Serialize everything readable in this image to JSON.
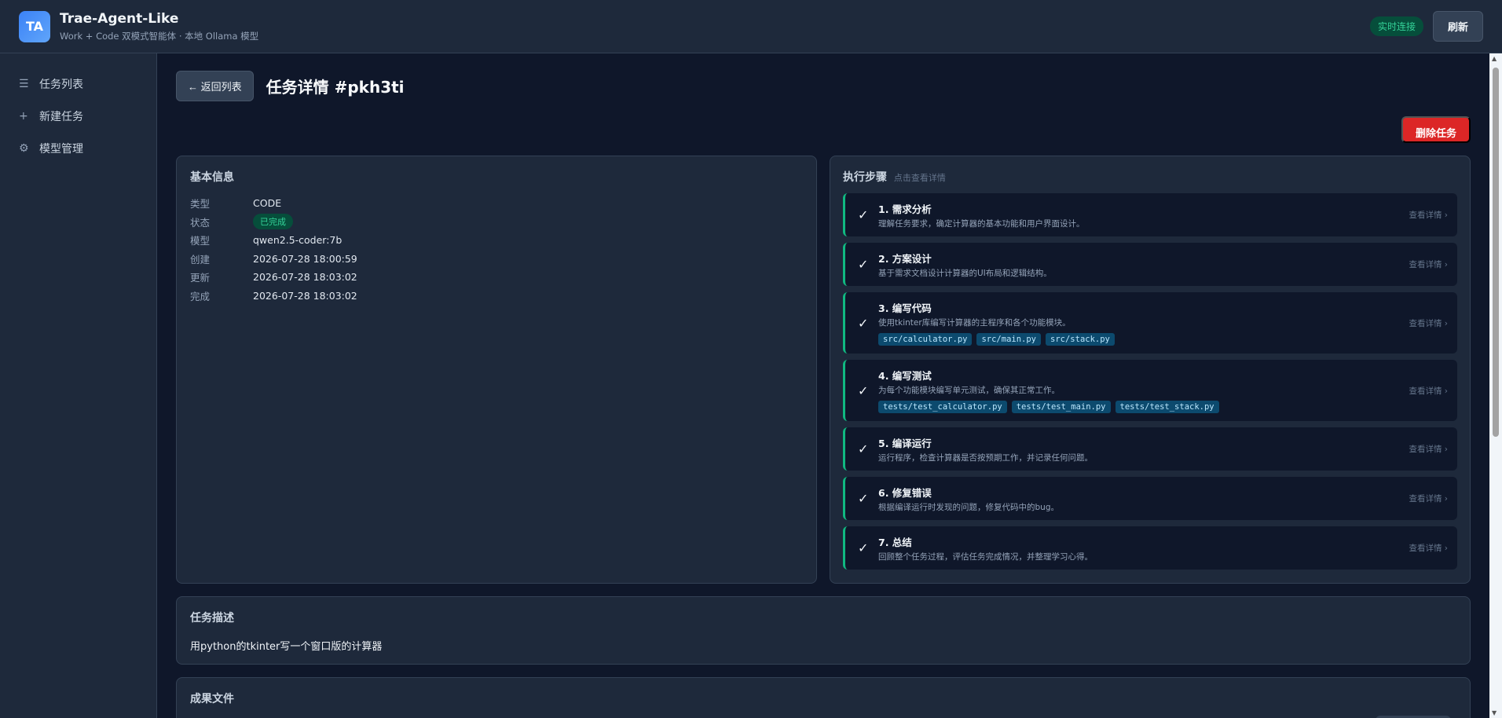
{
  "app": {
    "logo_text": "TA",
    "title": "Trae-Agent-Like",
    "subtitle": "Work + Code 双模式智能体 · 本地 Ollama 模型",
    "live_badge": "实时连接",
    "refresh_label": "刷新"
  },
  "sidebar": {
    "items": [
      {
        "icon": "list-icon",
        "glyph": "☰",
        "label": "任务列表"
      },
      {
        "icon": "plus-icon",
        "glyph": "+",
        "label": "新建任务"
      },
      {
        "icon": "gear-icon",
        "glyph": "⚙",
        "label": "模型管理"
      }
    ]
  },
  "header": {
    "back_label": "← 返回列表",
    "title": "任务详情 #pkh3ti",
    "delete_label": "删除任务"
  },
  "info": {
    "title": "基本信息",
    "rows": [
      {
        "label": "类型",
        "value": "CODE"
      },
      {
        "label": "状态",
        "value": "已完成"
      },
      {
        "label": "模型",
        "value": "qwen2.5-coder:7b"
      },
      {
        "label": "创建",
        "value": "2026-07-28 18:00:59"
      },
      {
        "label": "更新",
        "value": "2026-07-28 18:03:02"
      },
      {
        "label": "完成",
        "value": "2026-07-28 18:03:02"
      }
    ]
  },
  "steps": {
    "title": "执行步骤",
    "hint": "点击查看详情",
    "link_label": "查看详情 ›",
    "check_glyph": "✓",
    "items": [
      {
        "name": "1. 需求分析",
        "desc": "理解任务要求，确定计算器的基本功能和用户界面设计。",
        "files": []
      },
      {
        "name": "2. 方案设计",
        "desc": "基于需求文档设计计算器的UI布局和逻辑结构。",
        "files": []
      },
      {
        "name": "3. 编写代码",
        "desc": "使用tkinter库编写计算器的主程序和各个功能模块。",
        "files": [
          "src/calculator.py",
          "src/main.py",
          "src/stack.py"
        ]
      },
      {
        "name": "4. 编写测试",
        "desc": "为每个功能模块编写单元测试，确保其正常工作。",
        "files": [
          "tests/test_calculator.py",
          "tests/test_main.py",
          "tests/test_stack.py"
        ]
      },
      {
        "name": "5. 编译运行",
        "desc": "运行程序，检查计算器是否按预期工作，并记录任何问题。",
        "files": []
      },
      {
        "name": "6. 修复错误",
        "desc": "根据编译运行时发现的问题，修复代码中的bug。",
        "files": []
      },
      {
        "name": "7. 总结",
        "desc": "回顾整个任务过程，评估任务完成情况，并整理学习心得。",
        "files": []
      }
    ]
  },
  "description": {
    "title": "任务描述",
    "text": "用python的tkinter写一个窗口版的计算器"
  },
  "artifacts": {
    "title": "成果文件"
  }
}
